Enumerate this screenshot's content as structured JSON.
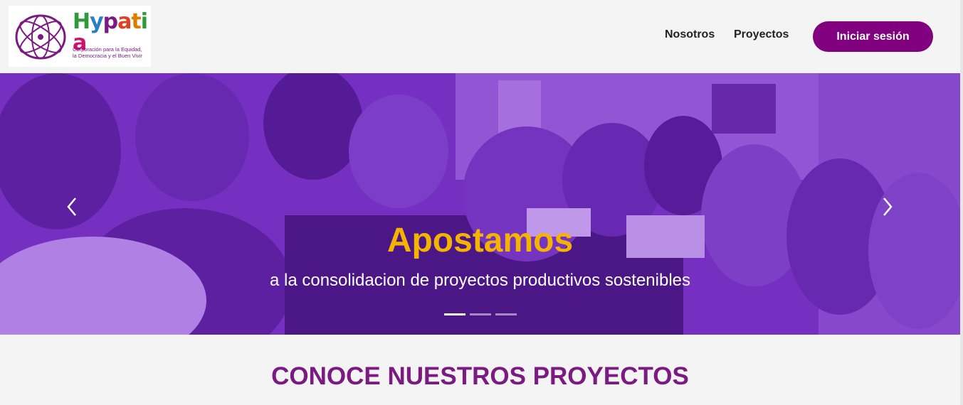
{
  "brand": {
    "wordmark_letters": [
      "H",
      "y",
      "p",
      "a",
      "t",
      "i",
      "a"
    ],
    "wordmark_colors": [
      "#2f9a3a",
      "#2a7fc0",
      "#7b1a80",
      "#e04020",
      "#e07b00",
      "#2f9a3a",
      "#d0106a"
    ],
    "tagline_line1": "Corporación para la Equidad,",
    "tagline_line2": "la Democracia y el Buen Vivir"
  },
  "nav": {
    "items": [
      {
        "label": "Nosotros"
      },
      {
        "label": "Proyectos"
      }
    ],
    "login_label": "Iniciar sesión"
  },
  "hero": {
    "title": "Apostamos",
    "subtitle": "a la consolidacion de proyectos productivos sostenibles",
    "slide_count": 3,
    "active_slide": 1,
    "prev_icon": "chevron-left-icon",
    "next_icon": "chevron-right-icon"
  },
  "section": {
    "title": "CONOCE NUESTROS PROYECTOS"
  },
  "colors": {
    "brand_purple": "#800080",
    "title_purple": "#7b1a80",
    "hero_accent": "#f5b301",
    "hero_overlay": "#6a2bb4"
  }
}
